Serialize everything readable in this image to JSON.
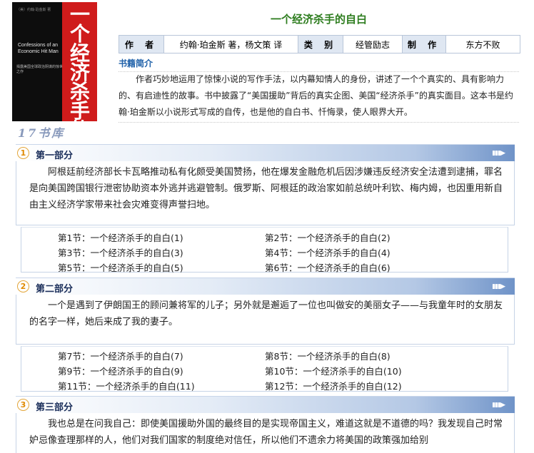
{
  "book": {
    "title": "一个经济杀手的自白",
    "cover_title": "一个经济杀手的自白",
    "cover_en": "Confessions of an Economic Hit Man",
    "cover_top": "（美）约翰·珀金斯 著",
    "cover_sub": "揭露美国全球政治阴谋的惊世之作",
    "site_logo": "17书库"
  },
  "info": {
    "author_label": "作 者",
    "author_value": "约翰·珀金斯 著，杨文策 译",
    "category_label": "类 别",
    "category_value": "经管励志",
    "maker_label": "制 作",
    "maker_value": "东方不败"
  },
  "intro": {
    "heading": "书籍简介",
    "text": "作者巧妙地运用了惊悚小说的写作手法，以内幕知情人的身份，讲述了一个个真实的、具有影响力的、有启迪性的故事。书中披露了“美国援助”背后的真实企图、美国“经济杀手”的真实面目。这本书是约翰·珀金斯以小说形式写成的自传，也是他的自白书、忏悔录，使人眼界大开。"
  },
  "sections": [
    {
      "num": "1",
      "title": "第一部分",
      "desc": "阿根廷前经济部长卡瓦略推动私有化颇受美国赞扬，他在爆发金融危机后因涉嫌违反经济安全法遭到逮捕，罪名是向美国跨国银行泄密协助资本外逃并逃避管制。俄罗斯、阿根廷的政治家如前总统叶利钦、梅内姆，也因重用新自由主义经济学家带来社会灾难变得声誉扫地。",
      "chapters": [
        "第1节：一个经济杀手的自白(1)",
        "第2节：一个经济杀手的自白(2)",
        "第3节：一个经济杀手的自白(3)",
        "第4节：一个经济杀手的自白(4)",
        "第5节：一个经济杀手的自白(5)",
        "第6节：一个经济杀手的自白(6)"
      ]
    },
    {
      "num": "2",
      "title": "第二部分",
      "desc": "一个是遇到了伊朗国王的顾问兼将军的儿子；另外就是邂逅了一位也叫做安的美丽女子——与我童年时的女朋友的名字一样，她后来成了我的妻子。",
      "chapters": [
        "第7节：一个经济杀手的自白(7)",
        "第8节：一个经济杀手的自白(8)",
        "第9节：一个经济杀手的自白(9)",
        "第10节：一个经济杀手的自白(10)",
        "第11节：一个经济杀手的自白(11)",
        "第12节：一个经济杀手的自白(12)"
      ]
    },
    {
      "num": "3",
      "title": "第三部分",
      "desc": "我也总是在问我自己：即使美国援助外国的最终目的是实现帝国主义，难道这就是不道德的吗？我发现自己时常妒忌像查理那样的人，他们对我们国家的制度绝对信任，所以他们不遗余力将美国的政策强加给别"
    }
  ],
  "colors": {
    "title_green": "#2e7d1f",
    "link_blue": "#1d5fa8",
    "badge_orange": "#e08a00"
  }
}
